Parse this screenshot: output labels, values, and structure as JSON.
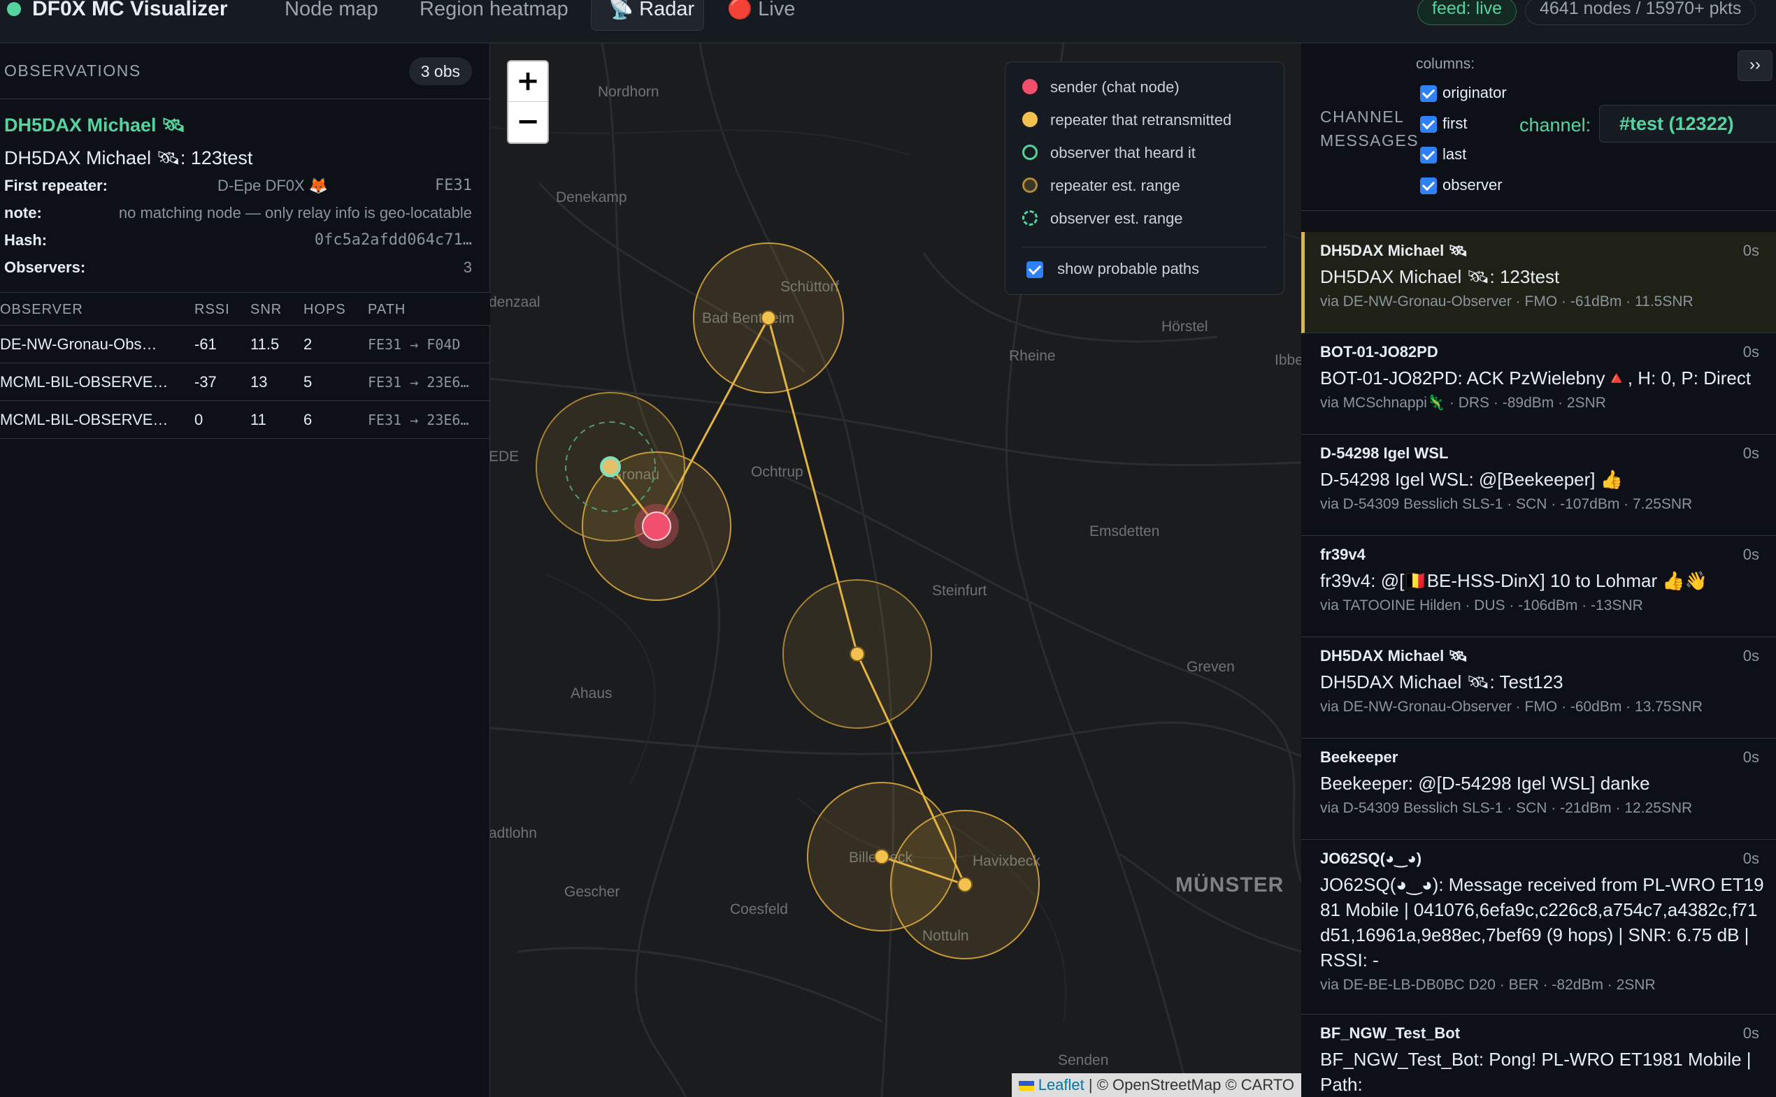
{
  "app": {
    "title": "DF0X MC Visualizer",
    "tabs": [
      {
        "label": "Node map"
      },
      {
        "label": "Region heatmap"
      },
      {
        "label": "📡 Radar"
      },
      {
        "label": "🔴 Live"
      }
    ],
    "feed_status": "feed: live",
    "node_stats": "4641 nodes / 15970+ pkts",
    "colors": {
      "accent": "#56d4a0",
      "repeater": "#e3b341",
      "sender": "#f0506e"
    }
  },
  "observations": {
    "title": "OBSERVATIONS",
    "count": "3 obs",
    "sender_name": "DH5DAX Michael 🛰",
    "message": "DH5DAX Michael 🛰: 123test",
    "first_repeater_label": "First repeater:",
    "first_repeater_value": "D-Epe DF0X 🦊",
    "first_repeater_code": "FE31",
    "note_label": "note:",
    "note_value": "no matching node — only relay info is geo-locatable",
    "hash_label": "Hash:",
    "hash_value": "0fc5a2afdd064c71…",
    "observers_label": "Observers:",
    "observers_value": "3",
    "table": {
      "headers": {
        "observer": "OBSERVER",
        "rssi": "RSSI",
        "snr": "SNR",
        "hops": "HOPS",
        "path": "PATH"
      },
      "rows": [
        {
          "observer": "DE-NW-Gronau-Obs…",
          "rssi": "-61",
          "snr": "11.5",
          "hops": "2",
          "path": "FE31 → F04D"
        },
        {
          "observer": "MCML-BIL-OBSERVE…",
          "rssi": "-37",
          "snr": "13",
          "hops": "5",
          "path": "FE31 → 23E6…"
        },
        {
          "observer": "MCML-BIL-OBSERVE…",
          "rssi": "0",
          "snr": "11",
          "hops": "6",
          "path": "FE31 → 23E6…"
        }
      ]
    }
  },
  "map": {
    "zoom_in": "+",
    "zoom_out": "−",
    "towns": {
      "nordhorn": "Nordhorn",
      "denekamp": "Denekamp",
      "denzaal": "denzaal",
      "schuttorf": "Schüttorf",
      "bad_bentheim": "Bad Bentheim",
      "horstel": "Hörstel",
      "rheine": "Rheine",
      "ibbe": "Ibbe",
      "ede": "EDE",
      "gronau": "Gronau",
      "ochtrup": "Ochtrup",
      "emsdetten": "Emsdetten",
      "steinfurt": "Steinfurt",
      "ahaus": "Ahaus",
      "greven": "Greven",
      "stadtlohn": "adtlohn",
      "billerbeck": "Billerbeck",
      "havixbeck": "Havixbeck",
      "munster": "MÜNSTER",
      "gescher": "Gescher",
      "coesfeld": "Coesfeld",
      "nottuln": "Nottuln",
      "senden": "Senden"
    },
    "legend": {
      "sender": "sender (chat node)",
      "repeater": "repeater that retransmitted",
      "observer": "observer that heard it",
      "repeater_range": "repeater est. range",
      "observer_range": "observer est. range",
      "show_paths": "show probable paths"
    },
    "attribution_link": "Leaflet",
    "attribution_text": "| © OpenStreetMap © CARTO"
  },
  "channel": {
    "title": "CHANNEL MESSAGES",
    "columns_label": "columns:",
    "columns": [
      {
        "label": "originator"
      },
      {
        "label": "first"
      },
      {
        "label": "last"
      },
      {
        "label": "observer"
      }
    ],
    "channel_label": "channel:",
    "channel_value": "#test (12322)",
    "collapse": "››",
    "messages": [
      {
        "from": "DH5DAX Michael 🛰",
        "time": "0s",
        "text": "DH5DAX Michael 🛰: 123test",
        "via": "via DE-NW-Gronau-Observer · FMO · -61dBm · 11.5SNR"
      },
      {
        "from": "BOT-01-JO82PD",
        "time": "0s",
        "text": "BOT-01-JO82PD: ACK PzWielebny🔺, H: 0, P: Direct",
        "via": "via MCSchnappi🦎 · DRS · -89dBm · 2SNR"
      },
      {
        "from": "D-54298 Igel WSL",
        "time": "0s",
        "text": "D-54298 Igel WSL: @[Beekeeper] 👍",
        "via": "via D-54309 Besslich SLS-1 · SCN · -107dBm · 7.25SNR"
      },
      {
        "from": "fr39v4",
        "time": "0s",
        "text": "fr39v4: @[🇧🇪BE-HSS-DinX] 10 to Lohmar 👍👋",
        "via": "via TATOOINE Hilden · DUS · -106dBm · -13SNR"
      },
      {
        "from": "DH5DAX Michael 🛰",
        "time": "0s",
        "text": "DH5DAX Michael 🛰: Test123",
        "via": "via DE-NW-Gronau-Observer · FMO · -60dBm · 13.75SNR"
      },
      {
        "from": "Beekeeper",
        "time": "0s",
        "text": "Beekeeper: @[D-54298 Igel WSL] danke",
        "via": "via D-54309 Besslich SLS-1 · SCN · -21dBm · 12.25SNR"
      },
      {
        "from": "JO62SQ(◕‿◕)",
        "time": "0s",
        "text": "JO62SQ(◕‿◕): Message received from PL-WRO ET1981 Mobile | 041076,6efa9c,c226c8,a754c7,a4382c,f71d51,16961a,9e88ec,7bef69 (9 hops) | SNR: 6.75 dB | RSSI: -",
        "via": "via DE-BE-LB-DB0BC D20 · BER · -82dBm · 2SNR"
      },
      {
        "from": "BF_NGW_Test_Bot",
        "time": "0s",
        "text": "BF_NGW_Test_Bot: Pong! PL-WRO ET1981 Mobile | Path:",
        "via": ""
      }
    ]
  }
}
